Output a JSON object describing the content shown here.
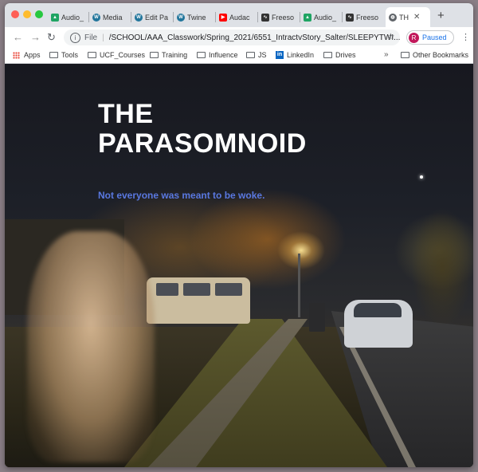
{
  "browser": {
    "tabs": [
      {
        "label": "Audio_",
        "icon": "google-drive-icon",
        "color": "#1fa463"
      },
      {
        "label": "Media",
        "icon": "wordpress-icon",
        "color": "#21759b"
      },
      {
        "label": "Edit Pa",
        "icon": "wordpress-icon",
        "color": "#21759b"
      },
      {
        "label": "Twine",
        "icon": "wordpress-icon",
        "color": "#21759b"
      },
      {
        "label": "Audac",
        "icon": "youtube-icon",
        "color": "#ff0000"
      },
      {
        "label": "Freeso",
        "icon": "freesound-icon",
        "color": "#333333"
      },
      {
        "label": "Audio_",
        "icon": "google-drive-icon",
        "color": "#1fa463"
      },
      {
        "label": "Freeso",
        "icon": "freesound-icon",
        "color": "#333333"
      },
      {
        "label": "TH",
        "icon": "globe-icon",
        "color": "#5f6368",
        "active": true
      }
    ],
    "new_tab": "+",
    "address": {
      "scheme": "File",
      "url": "/SCHOOL/AAA_Classwork/Spring_2021/6551_IntractvStory_Salter/SLEEPYTWI..."
    },
    "profile": {
      "initial": "R",
      "label": "Paused"
    },
    "bookmarks": [
      {
        "label": "Apps",
        "icon": "apps-grid-icon"
      },
      {
        "label": "Tools",
        "icon": "folder-icon"
      },
      {
        "label": "UCF_Courses",
        "icon": "folder-icon"
      },
      {
        "label": "Training",
        "icon": "folder-icon"
      },
      {
        "label": "Influence",
        "icon": "folder-icon"
      },
      {
        "label": "JS",
        "icon": "folder-icon"
      },
      {
        "label": "LinkedIn",
        "icon": "linkedin-icon"
      },
      {
        "label": "Drives",
        "icon": "folder-icon"
      }
    ],
    "more_bookmarks": "»",
    "other_bookmarks": "Other Bookmarks"
  },
  "page": {
    "title_line1": "THE",
    "title_line2": "PARASOMNOID",
    "tagline": "Not everyone was meant to be woke.",
    "title_color": "#ffffff",
    "tagline_color": "#5978e0"
  }
}
